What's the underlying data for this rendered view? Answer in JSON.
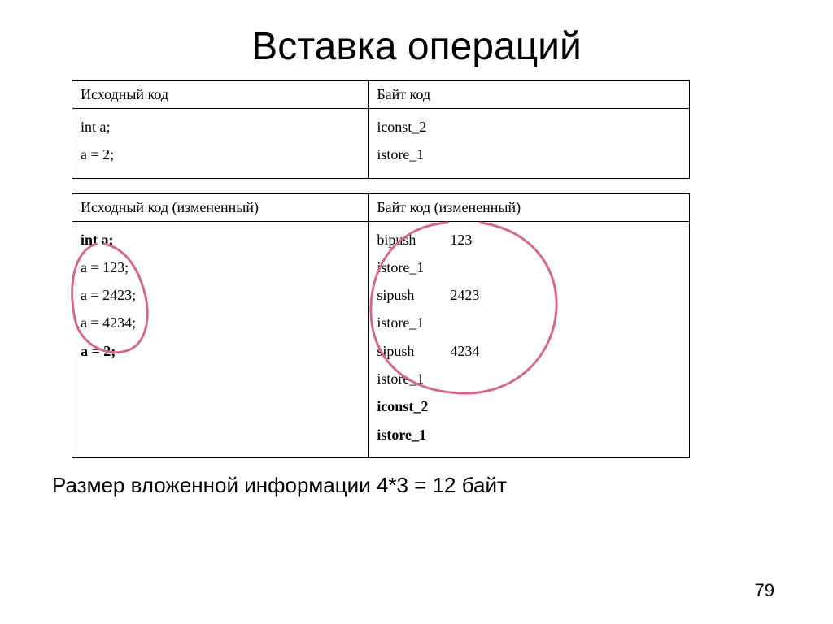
{
  "title": "Вставка операций",
  "table1": {
    "headers": [
      "Исходный код",
      "Байт код"
    ],
    "left": [
      "int a;",
      "a = 2;"
    ],
    "right": [
      "iconst_2",
      "istore_1"
    ]
  },
  "table2": {
    "headers": [
      "Исходный код (измененный)",
      "Байт код (измененный)"
    ],
    "left": [
      {
        "text": "int a;",
        "bold": true
      },
      {
        "text": "a = 123;",
        "bold": false
      },
      {
        "text": "a = 2423;",
        "bold": false
      },
      {
        "text": "a = 4234;",
        "bold": false
      },
      {
        "text": "a = 2;",
        "bold": true
      }
    ],
    "right": [
      {
        "op": "bipush",
        "arg": "123",
        "bold": false
      },
      {
        "op": "istore_1",
        "arg": "",
        "bold": false
      },
      {
        "op": "sipush",
        "arg": "2423",
        "bold": false
      },
      {
        "op": "istore_1",
        "arg": "",
        "bold": false
      },
      {
        "op": "sipush",
        "arg": "4234",
        "bold": false
      },
      {
        "op": "istore_1",
        "arg": "",
        "bold": false
      },
      {
        "op": "iconst_2",
        "arg": "",
        "bold": true
      },
      {
        "op": "istore_1",
        "arg": "",
        "bold": true
      }
    ]
  },
  "caption": "Размер вложенной информации 4*3 = 12 байт",
  "page_number": "79",
  "annotation_color": "#d46a8a"
}
